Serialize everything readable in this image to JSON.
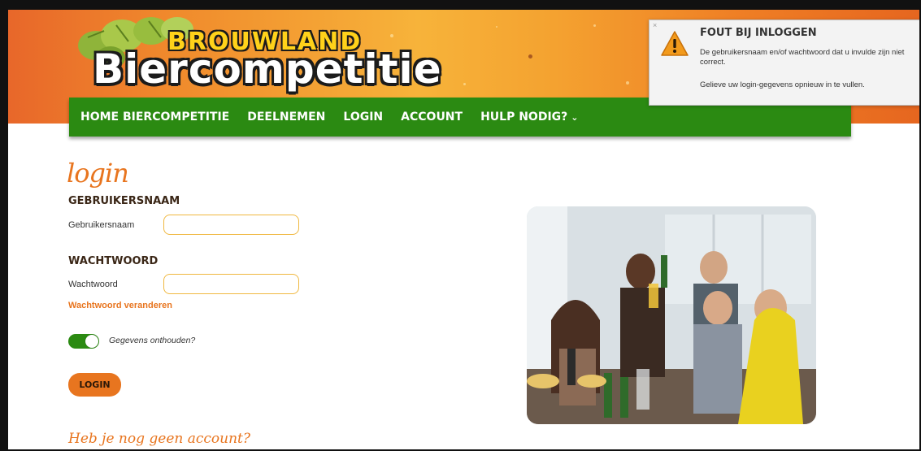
{
  "brand": {
    "top": "BROUWLAND",
    "main": "Biercompetitie"
  },
  "nav": {
    "items": [
      {
        "label": "HOME BIERCOMPETITIE"
      },
      {
        "label": "DEELNEMEN"
      },
      {
        "label": "LOGIN"
      },
      {
        "label": "ACCOUNT"
      },
      {
        "label": "HULP NODIG?"
      }
    ]
  },
  "alert": {
    "title": "FOUT BIJ INLOGGEN",
    "message": "De gebruikersnaam en/of wachtwoord dat u invulde zijn niet correct.",
    "hint": "Gelieve uw login-gegevens opnieuw in te vullen.",
    "close": "×"
  },
  "form": {
    "title": "login",
    "username_heading": "GEBRUIKERSNAAM",
    "username_label": "Gebruikersnaam",
    "username_value": "",
    "password_heading": "WACHTWOORD",
    "password_label": "Wachtwoord",
    "password_value": "",
    "change_password": "Wachtwoord veranderen",
    "remember_label": "Gegevens onthouden?",
    "remember_on": true,
    "submit": "LOGIN",
    "no_account": "Heb je nog geen account?"
  },
  "colors": {
    "nav_green": "#2b8a12",
    "accent_orange": "#e8751f",
    "input_border": "#f0b840"
  },
  "icons": [
    "warning-icon",
    "chevron-down-icon",
    "close-icon"
  ]
}
